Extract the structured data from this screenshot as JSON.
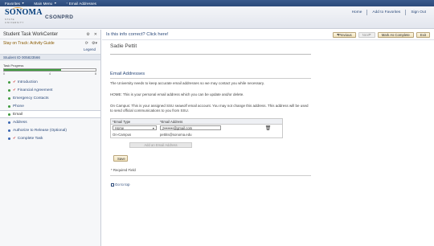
{
  "topbar": {
    "favorites": "Favorites",
    "main_menu": "Main Menu",
    "breadcrumb": "Email Addresses"
  },
  "header": {
    "logo_text": "SONOMA",
    "logo_sub": "STATE UNIVERSITY",
    "env": "CSONPRD",
    "links": [
      "Home",
      "Add to Favorites",
      "Sign Out"
    ]
  },
  "left": {
    "title": "Student Task WorkCenter",
    "activity": "Stay on Track: Activity Guide",
    "legend": "Legend",
    "student_id": "Student ID 005823566",
    "progress_label": "Task Progress",
    "progress_fraction": 0.62,
    "progress_ticks": [
      "0",
      "4",
      "8"
    ],
    "steps": [
      {
        "label": "Introduction",
        "done": true
      },
      {
        "label": "Financial Agreement",
        "done": true
      },
      {
        "label": "Emergency Contacts",
        "done": false
      },
      {
        "label": "Phone",
        "done": false
      },
      {
        "label": "Email",
        "done": false
      },
      {
        "label": "Address",
        "done": false
      },
      {
        "label": "Authorize to Release (Optional)",
        "done": false
      },
      {
        "label": "Complete Task",
        "done": true
      }
    ]
  },
  "main": {
    "question": "Is this info correct? Click here!",
    "buttons": {
      "previous": "Previous",
      "next": "Next",
      "mark_complete": "Mark As Complete",
      "exit": "Exit"
    },
    "name": "Sadie Pettit",
    "section_title": "Email Addresses",
    "para1": "The University needs to keep accurate email addresses so we may contact you while necessary.",
    "para2": "HOME: This is your personal email address which you can be update and/or delete.",
    "para3": "On Campus: This is your assigned SSU seawolf email account. You may not change this address. This address will be used to send official communications to you from SSU.",
    "grid": {
      "col_type": "*Email Type",
      "col_addr": "*Email Address",
      "row1_type": "Home",
      "row1_addr": "z••••••••@gmail.com",
      "row2_type": "On-Campus",
      "row2_addr": "pettits@sonoma.edu"
    },
    "add_button": "Add an Email Address",
    "save": "Save",
    "required": "* Required Field",
    "go_to_top": "Go to top"
  },
  "colors": {
    "topbar": "#2c4a7a",
    "link": "#2c4a7a",
    "progress": "#3f9a3f",
    "button_gold": "#efe1bb"
  }
}
